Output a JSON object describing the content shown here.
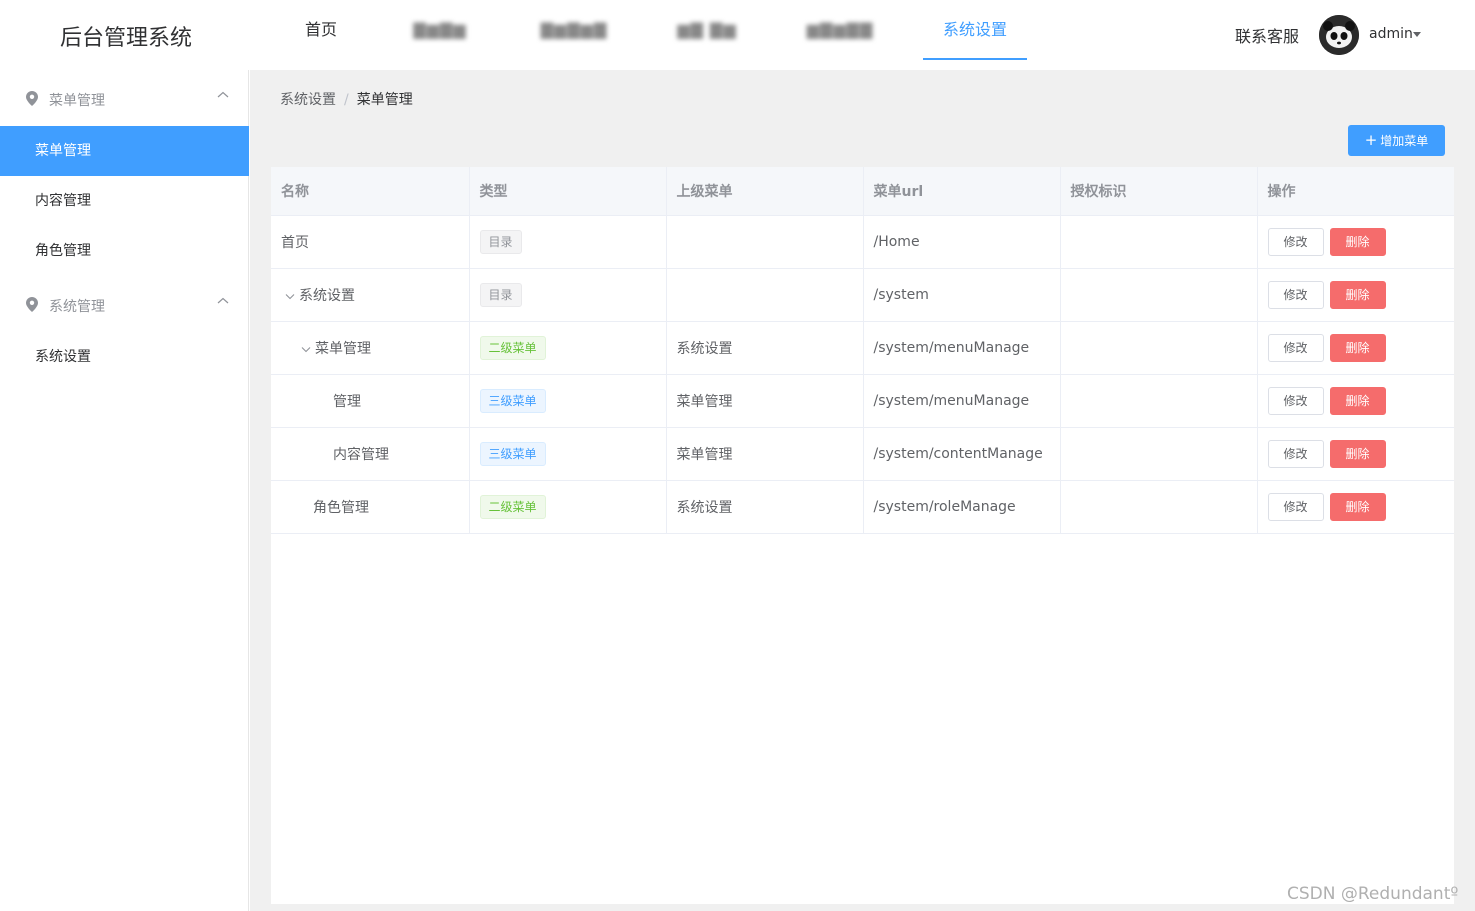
{
  "header": {
    "logo": "后台管理系统",
    "nav": [
      "首页",
      "▇▆▇▆",
      "▇▆▇▆▇",
      "▆▇ ▇▆",
      "▆▇▆▇▇",
      "系统设置"
    ],
    "active_nav": "系统设置",
    "contact": "联系客服",
    "username": "admin"
  },
  "sidebar": {
    "groups": [
      {
        "title": "菜单管理",
        "items": [
          "菜单管理",
          "内容管理",
          "角色管理"
        ]
      },
      {
        "title": "系统管理",
        "items": [
          "系统设置"
        ]
      }
    ],
    "active_item": "菜单管理"
  },
  "breadcrumb": {
    "root": "系统设置",
    "current": "菜单管理"
  },
  "toolbar": {
    "add_label": "增加菜单"
  },
  "table": {
    "columns": [
      "名称",
      "类型",
      "上级菜单",
      "菜单url",
      "授权标识",
      "操作"
    ],
    "rows": [
      {
        "name": "首页",
        "indent": 0,
        "arrow": "",
        "type": "目录",
        "type_style": "gray",
        "parent": "",
        "url": "/Home",
        "perm": ""
      },
      {
        "name": "系统设置",
        "indent": 0,
        "arrow": "⌄",
        "type": "目录",
        "type_style": "gray",
        "parent": "",
        "url": "/system",
        "perm": ""
      },
      {
        "name": "菜单管理",
        "indent": 1,
        "arrow": "⌄",
        "type": "二级菜单",
        "type_style": "green",
        "parent": "系统设置",
        "url": "/system/menuManage",
        "perm": ""
      },
      {
        "name": "管理",
        "indent": 2,
        "arrow": "",
        "type": "三级菜单",
        "type_style": "blue",
        "parent": "菜单管理",
        "url": "/system/menuManage",
        "perm": ""
      },
      {
        "name": "内容管理",
        "indent": 2,
        "arrow": "",
        "type": "三级菜单",
        "type_style": "blue",
        "parent": "菜单管理",
        "url": "/system/contentManage",
        "perm": ""
      },
      {
        "name": "角色管理",
        "indent": 1,
        "arrow": "",
        "type": "二级菜单",
        "type_style": "green",
        "parent": "系统设置",
        "url": "/system/roleManage",
        "perm": ""
      }
    ],
    "edit_label": "修改",
    "delete_label": "删除"
  },
  "watermark": "CSDN @Redundantº",
  "colors": {
    "primary": "#409eff",
    "danger": "#f56c6c",
    "success": "#67c23a"
  }
}
